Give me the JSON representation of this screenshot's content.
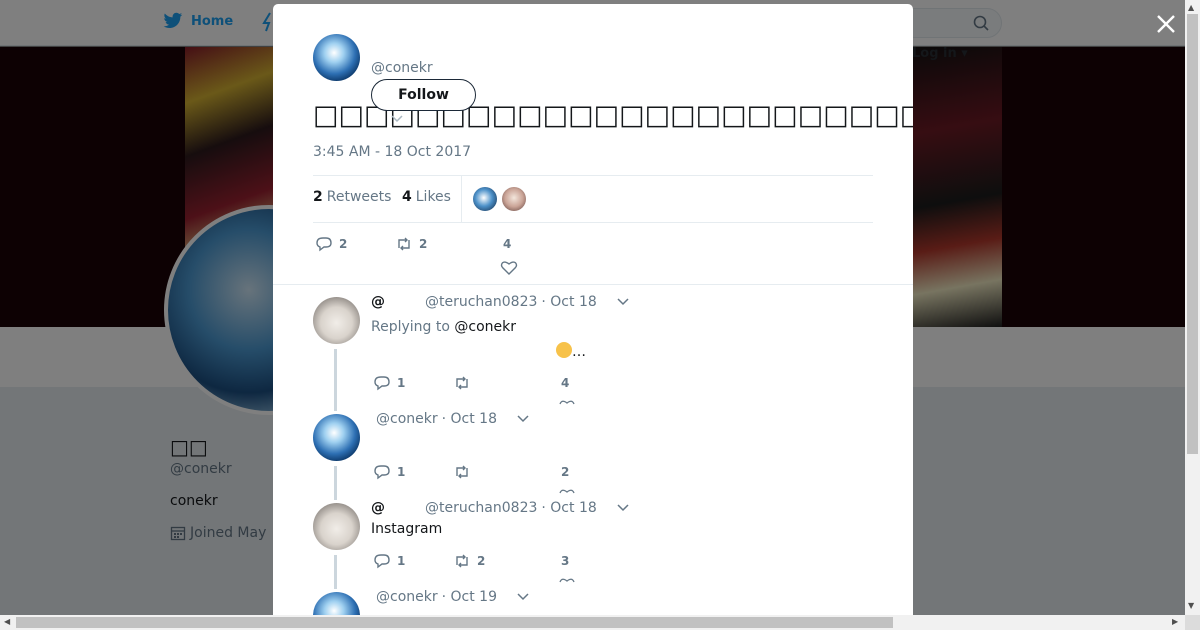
{
  "nav": {
    "home_label": "Home",
    "login_label": "Log in ▾"
  },
  "profile": {
    "name": "□□",
    "handle": "@conekr",
    "bio": "conekr",
    "joined": "Joined May"
  },
  "tweet": {
    "handle": "@conekr",
    "follow_label": "Follow",
    "text": "□□□□□□□□□□□□□□□□□□□□□□□□□□□□□□□□□□□□□□□□□□□□□□□□□",
    "timestamp": "3:45 AM - 18 Oct 2017",
    "retweets_count": "2",
    "retweets_label": "Retweets",
    "likes_count": "4",
    "likes_label": "Likes",
    "reply_count": "2",
    "retweet_count": "2",
    "like_count": "4"
  },
  "replies": [
    {
      "at": "@",
      "handle": "@teruchan0823",
      "date": "· Oct 18",
      "replying_to_label": "Replying to",
      "replying_to": "@conekr",
      "text_tail": "…",
      "reply_count": "1",
      "retweet_count": "",
      "like_count": "4"
    },
    {
      "handle": "@conekr",
      "date": "· Oct 18",
      "reply_count": "1",
      "retweet_count": "",
      "like_count": "2"
    },
    {
      "at": "@",
      "handle": "@teruchan0823",
      "date": "· Oct 18",
      "text": "Instagram",
      "reply_count": "1",
      "retweet_count": "2",
      "like_count": "3"
    },
    {
      "handle": "@conekr",
      "date": "· Oct 19"
    }
  ],
  "colors": {
    "accent": "#1da1f2",
    "muted": "#657786",
    "text": "#14171a"
  },
  "icons": [
    "twitter-bird-icon",
    "search-icon",
    "close-icon",
    "reply-icon",
    "retweet-icon",
    "heart-icon",
    "chevron-down-icon",
    "calendar-icon"
  ]
}
